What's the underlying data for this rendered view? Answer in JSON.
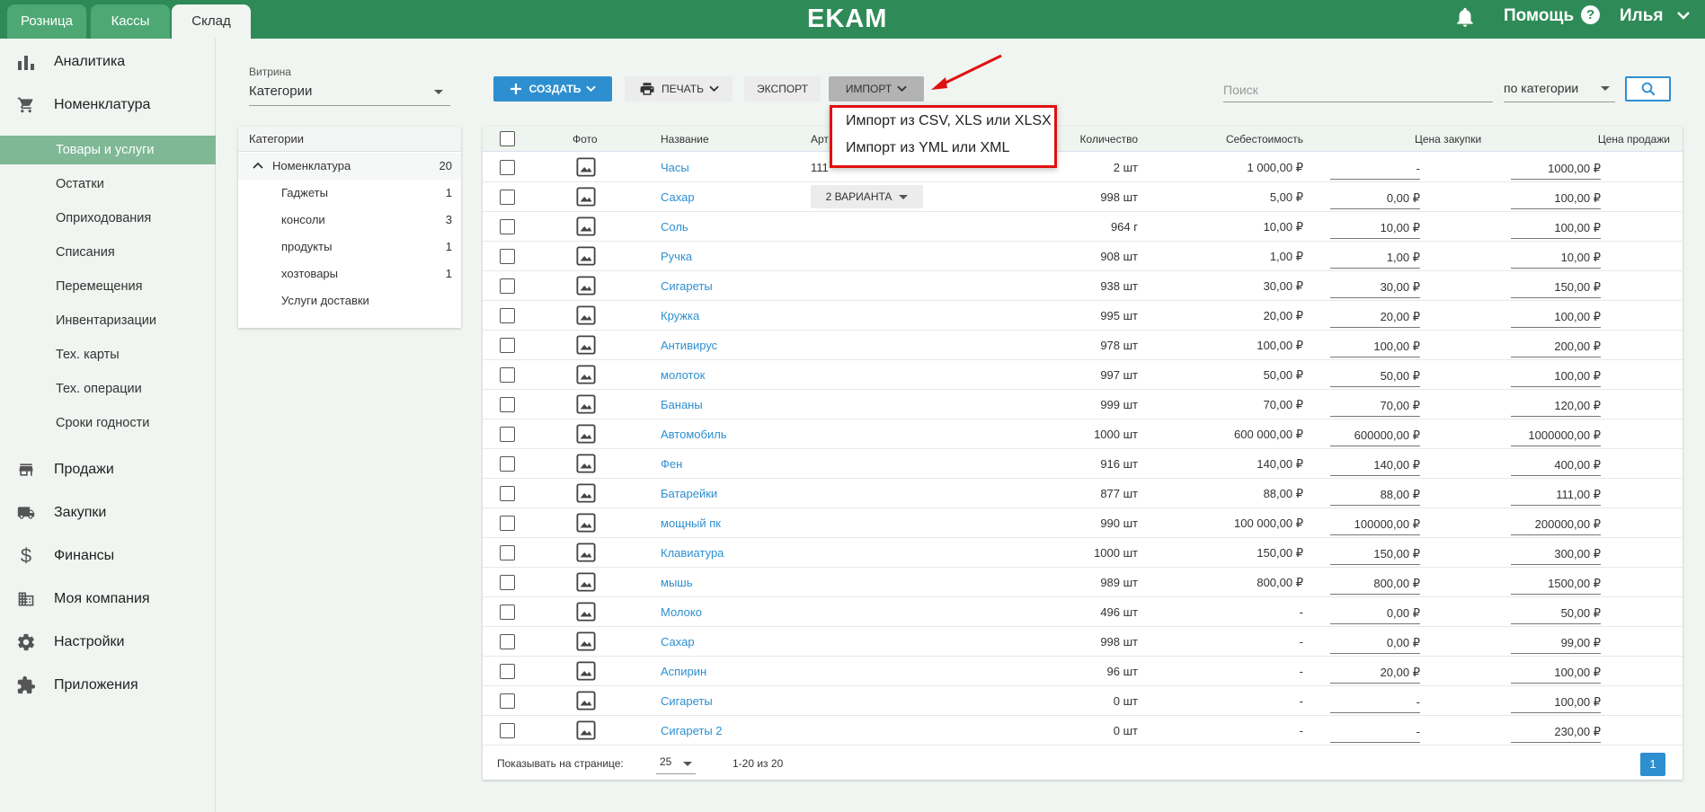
{
  "topbar": {
    "tabs": [
      {
        "label": "Розница"
      },
      {
        "label": "Кассы"
      },
      {
        "label": "Склад"
      }
    ],
    "logo": "EKAM",
    "help": "Помощь",
    "help_q": "?",
    "user": "Илья"
  },
  "sidebar": {
    "sections_top": [
      {
        "label": "Аналитика",
        "icon": "bar-chart-icon"
      },
      {
        "label": "Номенклатура",
        "icon": "cart-icon"
      }
    ],
    "sub_items": [
      {
        "label": "Товары и услуги",
        "active": true
      },
      {
        "label": "Остатки"
      },
      {
        "label": "Оприходования"
      },
      {
        "label": "Списания"
      },
      {
        "label": "Перемещения"
      },
      {
        "label": "Инвентаризации"
      },
      {
        "label": "Тех. карты"
      },
      {
        "label": "Тех. операции"
      },
      {
        "label": "Сроки годности"
      }
    ],
    "sections_bottom": [
      {
        "label": "Продажи",
        "icon": "store-icon"
      },
      {
        "label": "Закупки",
        "icon": "truck-icon"
      },
      {
        "label": "Финансы",
        "icon": "dollar-icon"
      },
      {
        "label": "Моя компания",
        "icon": "building-icon"
      },
      {
        "label": "Настройки",
        "icon": "gear-icon"
      },
      {
        "label": "Приложения",
        "icon": "puzzle-icon"
      }
    ]
  },
  "vitrina": {
    "label": "Витрина",
    "value": "Категории"
  },
  "categories": {
    "header": "Категории",
    "root": {
      "label": "Номенклатура",
      "count": "20"
    },
    "items": [
      {
        "label": "Гаджеты",
        "count": "1"
      },
      {
        "label": "консоли",
        "count": "3"
      },
      {
        "label": "продукты",
        "count": "1"
      },
      {
        "label": "хозтовары",
        "count": "1"
      },
      {
        "label": "Услуги доставки",
        "count": ""
      }
    ]
  },
  "toolbar": {
    "create": "СОЗДАТЬ",
    "print": "ПЕЧАТЬ",
    "export": "ЭКСПОРТ",
    "import": "ИМПОРТ",
    "search_placeholder": "Поиск",
    "search_by": "по категории"
  },
  "import_menu": {
    "items": [
      "Импорт из CSV, XLS или XLSX",
      "Импорт из YML или XML"
    ]
  },
  "table": {
    "headers": {
      "photo": "Фото",
      "name": "Название",
      "article": "Арт",
      "qty": "Количество",
      "cost": "Себестоимость",
      "purchase": "Цена закупки",
      "sale": "Цена продажи"
    },
    "variants_label": "2 ВАРИАНТА",
    "rows": [
      {
        "name": "Часы",
        "article": "111",
        "qty": "2 шт",
        "cost": "1 000,00 ₽",
        "purchase": "-",
        "purchase_cur": "",
        "sale": "1000,00 ₽"
      },
      {
        "name": "Сахар",
        "article": "",
        "qty": "998 шт",
        "cost": "5,00 ₽",
        "purchase": "0,00 ₽",
        "sale": "100,00 ₽",
        "variants": true
      },
      {
        "name": "Соль",
        "article": "",
        "qty": "964 г",
        "cost": "10,00 ₽",
        "purchase": "10,00 ₽",
        "sale": "100,00 ₽"
      },
      {
        "name": "Ручка",
        "article": "",
        "qty": "908 шт",
        "cost": "1,00 ₽",
        "purchase": "1,00 ₽",
        "sale": "10,00 ₽"
      },
      {
        "name": "Сигареты",
        "article": "",
        "qty": "938 шт",
        "cost": "30,00 ₽",
        "purchase": "30,00 ₽",
        "sale": "150,00 ₽"
      },
      {
        "name": "Кружка",
        "article": "",
        "qty": "995 шт",
        "cost": "20,00 ₽",
        "purchase": "20,00 ₽",
        "sale": "100,00 ₽"
      },
      {
        "name": "Антивирус",
        "article": "",
        "qty": "978 шт",
        "cost": "100,00 ₽",
        "purchase": "100,00 ₽",
        "sale": "200,00 ₽"
      },
      {
        "name": "молоток",
        "article": "",
        "qty": "997 шт",
        "cost": "50,00 ₽",
        "purchase": "50,00 ₽",
        "sale": "100,00 ₽"
      },
      {
        "name": "Бананы",
        "article": "",
        "qty": "999 шт",
        "cost": "70,00 ₽",
        "purchase": "70,00 ₽",
        "sale": "120,00 ₽"
      },
      {
        "name": "Автомобиль",
        "article": "",
        "qty": "1000 шт",
        "cost": "600 000,00 ₽",
        "purchase": "600000,00 ₽",
        "sale": "1000000,00 ₽"
      },
      {
        "name": "Фен",
        "article": "",
        "qty": "916 шт",
        "cost": "140,00 ₽",
        "purchase": "140,00 ₽",
        "sale": "400,00 ₽"
      },
      {
        "name": "Батарейки",
        "article": "",
        "qty": "877 шт",
        "cost": "88,00 ₽",
        "purchase": "88,00 ₽",
        "sale": "111,00 ₽"
      },
      {
        "name": "мощный пк",
        "article": "",
        "qty": "990 шт",
        "cost": "100 000,00 ₽",
        "purchase": "100000,00 ₽",
        "sale": "200000,00 ₽"
      },
      {
        "name": "Клавиатура",
        "article": "",
        "qty": "1000 шт",
        "cost": "150,00 ₽",
        "purchase": "150,00 ₽",
        "sale": "300,00 ₽"
      },
      {
        "name": "мышь",
        "article": "",
        "qty": "989 шт",
        "cost": "800,00 ₽",
        "purchase": "800,00 ₽",
        "sale": "1500,00 ₽"
      },
      {
        "name": "Молоко",
        "article": "",
        "qty": "496 шт",
        "cost": "-",
        "purchase": "0,00 ₽",
        "sale": "50,00 ₽"
      },
      {
        "name": "Сахар",
        "article": "",
        "qty": "998 шт",
        "cost": "-",
        "purchase": "0,00 ₽",
        "sale": "99,00 ₽"
      },
      {
        "name": "Аспирин",
        "article": "",
        "qty": "96 шт",
        "cost": "-",
        "purchase": "20,00 ₽",
        "sale": "100,00 ₽"
      },
      {
        "name": "Сигареты",
        "article": "",
        "qty": "0 шт",
        "cost": "-",
        "purchase": "-",
        "sale": "100,00 ₽"
      },
      {
        "name": "Сигареты 2",
        "article": "",
        "qty": "0 шт",
        "cost": "-",
        "purchase": "-",
        "sale": "230,00 ₽"
      }
    ]
  },
  "footer": {
    "per_page_label": "Показывать на странице:",
    "per_page_value": "25",
    "range": "1-20 из 20",
    "page": "1"
  },
  "colors": {
    "brand_green": "#2e8b57",
    "accent_blue": "#2e8fd0",
    "highlight_red": "#e01010"
  }
}
